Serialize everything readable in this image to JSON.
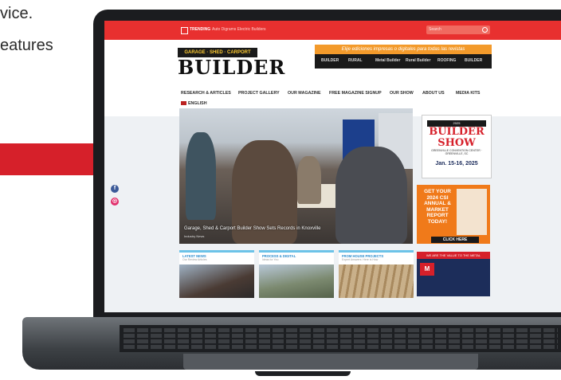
{
  "copy": {
    "line1": "vice.",
    "line2": "eatures"
  },
  "site": {
    "trending_label": "TRENDING",
    "trending_text": "Auto Digrams Electric Builders",
    "search_placeholder": "Search",
    "logo_top": "GARAGE · SHED · CARPORT",
    "logo_main": "BUILDER",
    "banner_title": "Elije ediciones impresas o digitales para todas las revistas",
    "banner_mags": [
      "BUILDER",
      "RURAL",
      "Metal Builder",
      "Rural Builder",
      "ROOFING",
      "BUILDER"
    ],
    "nav": [
      "RESEARCH & ARTICLES",
      "PROJECT GALLERY",
      "OUR MAGAZINE",
      "FREE MAGAZINE SIGNUP",
      "OUR SHOW",
      "ABOUT US",
      "MEDIA KITS"
    ],
    "language": "ENGLISH",
    "hero_caption": "Garage, Shed & Carport Builder Show Sets Records in Knoxville",
    "hero_sub": "Industry News",
    "social": [
      "f",
      "◎"
    ],
    "ad_show": {
      "top": "2025",
      "logo_line1": "BUILDER",
      "logo_line2": "SHOW",
      "sub": "GREENVILLE CONVENTION CENTER · GREENVILLE, SC",
      "date": "Jan. 15-16, 2025"
    },
    "ad_csi": {
      "text": "GET YOUR 2024 CSI ANNUAL & MARKET REPORT TODAY!",
      "button": "CLICK HERE"
    },
    "ad_mm": {
      "head": "WE ARE THE VALUE TO THE METAL",
      "logo": "M"
    },
    "cards": [
      {
        "title": "LATEST NEWS",
        "sub": "Our Review Articles"
      },
      {
        "title": "PROCESS & DIGITAL",
        "sub": "Ideas for You"
      },
      {
        "title": "FROM HOUSE PROJECTS",
        "sub": "Expert Answers: Here is How"
      }
    ]
  },
  "colors": {
    "brand_red": "#e8302f",
    "band_red": "#d6202a",
    "orange": "#f07a1a"
  }
}
